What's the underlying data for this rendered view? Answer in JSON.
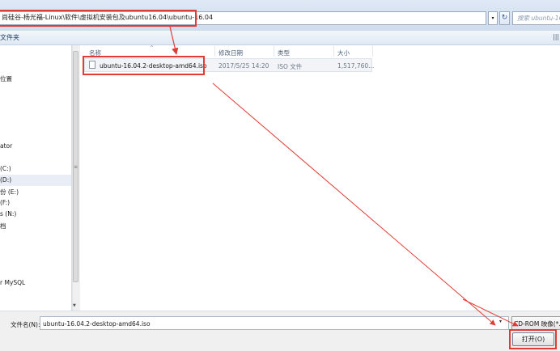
{
  "address": {
    "path": "尚硅谷-杨光福-Linux\\软件\\虚拟机安装包及ubuntu16.04\\ubuntu-16.04",
    "dropdown_glyph": "▾",
    "refresh_glyph": "↻",
    "search_placeholder": "搜索 ubuntu-16.04"
  },
  "toolbar": {
    "new_folder_label": "文件夹",
    "view_label": "|||"
  },
  "nav": {
    "items": [
      "位置",
      "ator",
      "(C:)",
      "(D:)",
      "份 (E:)",
      "(F:)",
      "s (N:)",
      "档",
      "r MySQL"
    ],
    "selected_index": 3,
    "scroll_down_glyph": "▼"
  },
  "columns": {
    "sort_glyph": "^",
    "headers": [
      "名称",
      "修改日期",
      "类型",
      "大小"
    ]
  },
  "file": {
    "name": "ubuntu-16.04.2-desktop-amd64.iso",
    "modified": "2017/5/25 14:20",
    "type": "ISO 文件",
    "size": "1,517,760..."
  },
  "bottom": {
    "filename_label": "文件名(N):",
    "filename_value": "ubuntu-16.04.2-desktop-amd64.iso",
    "filename_dropdown_glyph": "▾",
    "filter_value": "CD-ROM 映像(*.",
    "open_label": "打开(O)"
  },
  "colors": {
    "annotation": "#e23b35"
  }
}
